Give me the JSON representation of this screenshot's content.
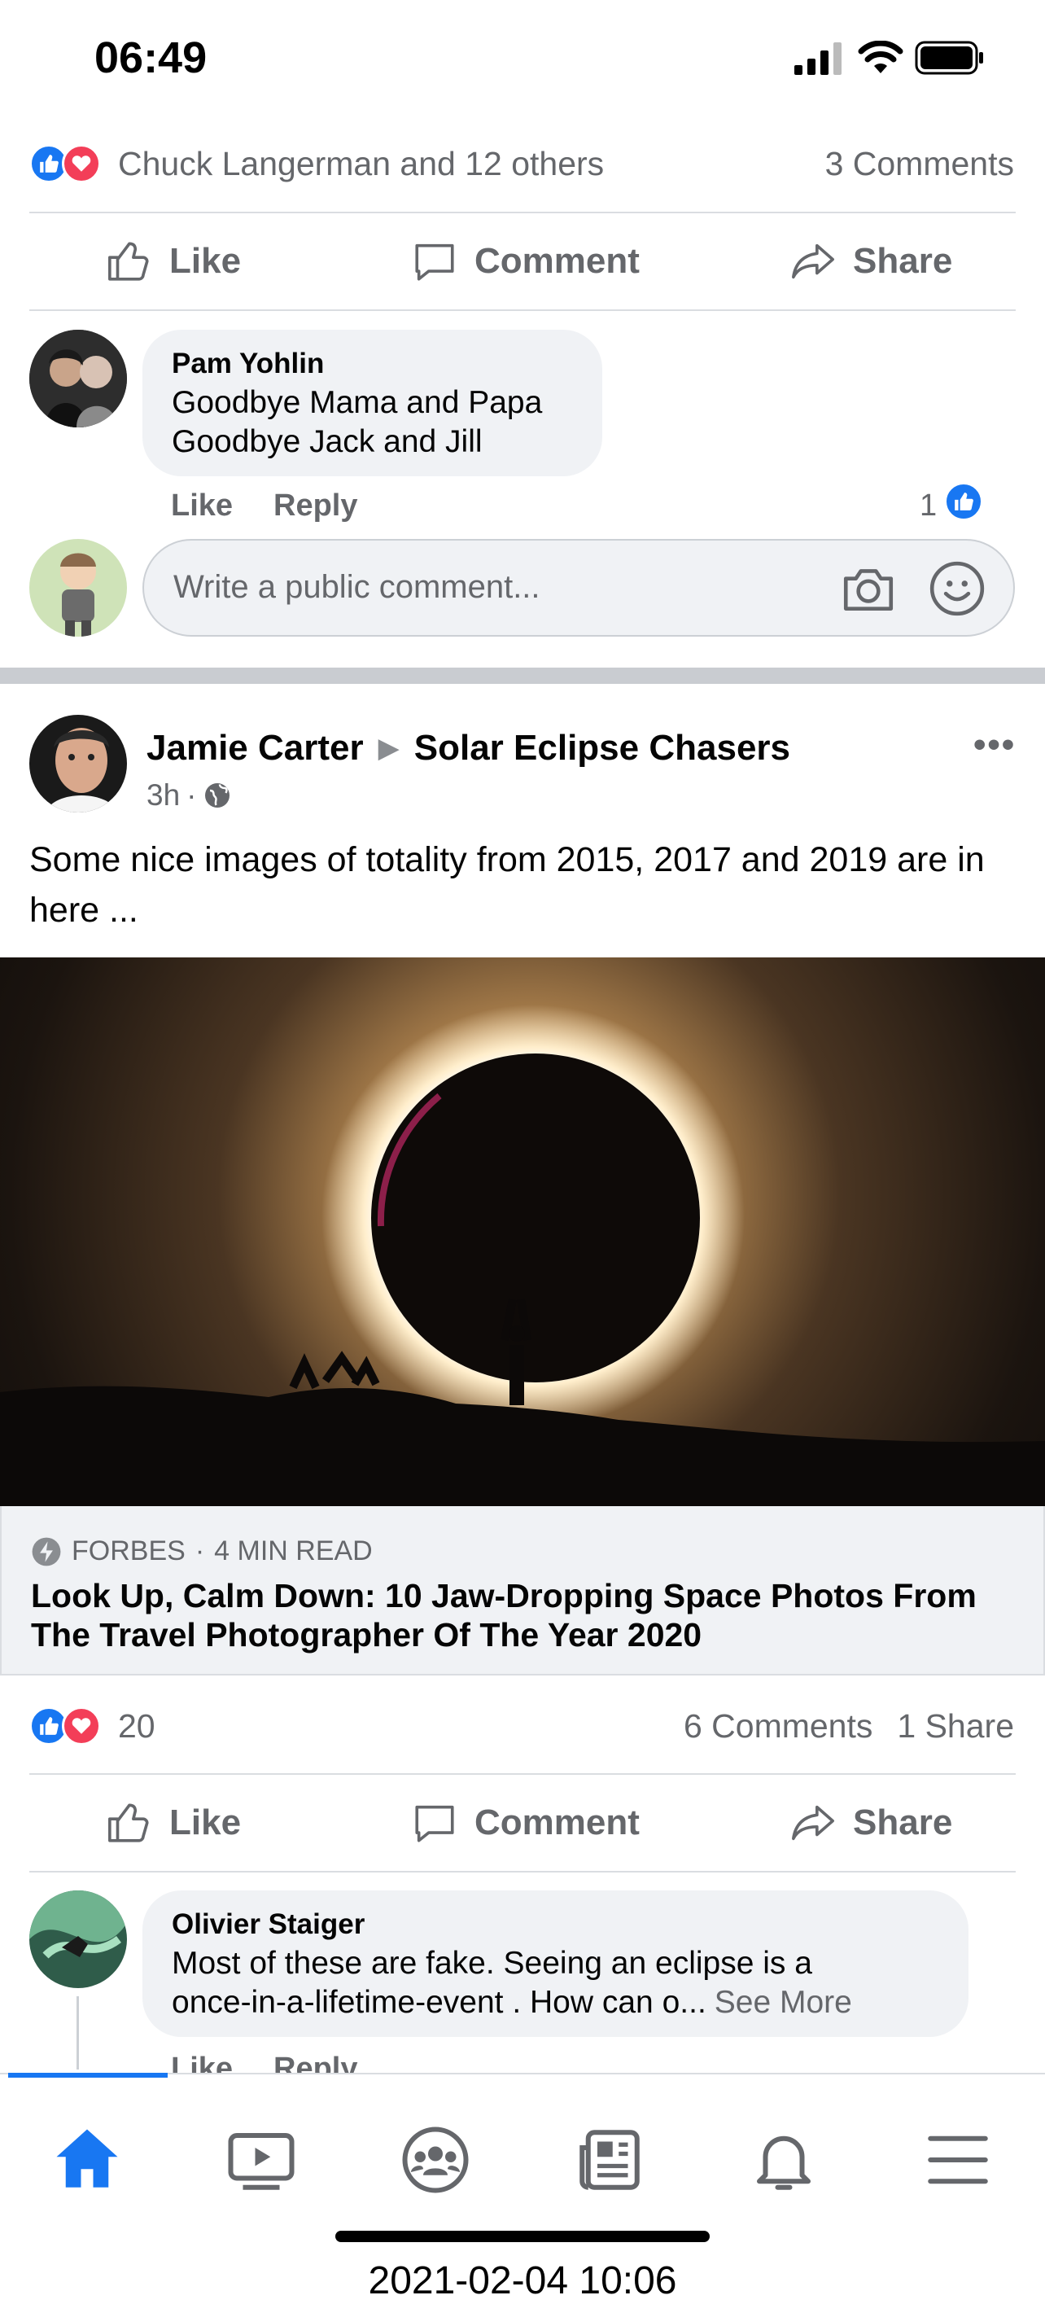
{
  "status_bar": {
    "time": "06:49"
  },
  "post1": {
    "reactions_text": "Chuck Langerman and 12 others",
    "comments_count": "3 Comments",
    "actions": {
      "like": "Like",
      "comment": "Comment",
      "share": "Share"
    },
    "comment": {
      "author": "Pam Yohlin",
      "line1": "Goodbye Mama and Papa",
      "line2": "Goodbye Jack and Jill",
      "like": "Like",
      "reply": "Reply",
      "like_count": "1"
    },
    "composer_placeholder": "Write a public comment..."
  },
  "post2": {
    "author": "Jamie Carter",
    "group": "Solar Eclipse Chasers",
    "time": "3h",
    "text": "Some nice images of totality from 2015, 2017 and 2019 are in here ...",
    "link": {
      "source": "FORBES",
      "read_time": "4 MIN READ",
      "title": "Look Up, Calm Down: 10 Jaw-Dropping Space Photos From The Travel Photographer Of The Year 2020"
    },
    "reaction_count": "20",
    "comments_count": "6 Comments",
    "shares_count": "1 Share",
    "actions": {
      "like": "Like",
      "comment": "Comment",
      "share": "Share"
    },
    "comment": {
      "author": "Olivier Staiger",
      "line1": "Most of these are fake. Seeing an eclipse is a",
      "line2": "once-in-a-lifetime-event . How can o...",
      "see_more": "See More",
      "like": "Like",
      "reply": "Reply"
    }
  },
  "bottom_nav": [
    "home-icon",
    "watch-icon",
    "groups-icon",
    "news-icon",
    "notifications-icon",
    "menu-icon"
  ],
  "timestamp_overlay": "2021-02-04 10:06",
  "colors": {
    "accent": "#1877f2",
    "love": "#f33e58",
    "divider": "#dadde1",
    "bubble": "#f0f2f5"
  }
}
